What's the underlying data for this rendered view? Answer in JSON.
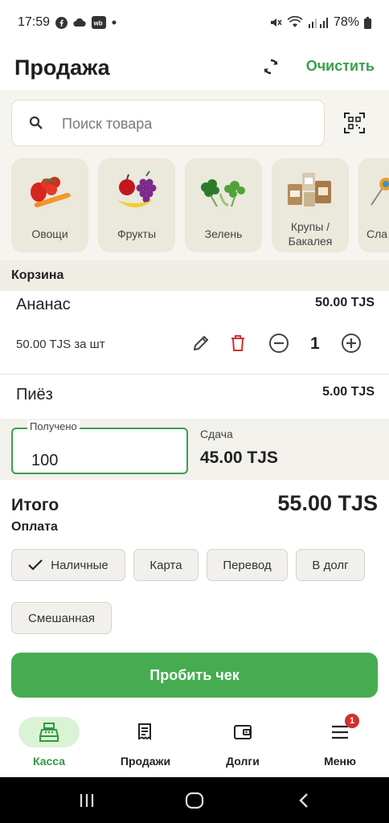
{
  "status_bar": {
    "time": "17:59",
    "battery": "78%"
  },
  "header": {
    "title": "Продажа",
    "clear_label": "Очистить"
  },
  "search": {
    "placeholder": "Поиск товара"
  },
  "categories": [
    {
      "label": "Овощи"
    },
    {
      "label": "Фрукты"
    },
    {
      "label": "Зелень"
    },
    {
      "label": "Крупы / Бакалея",
      "line1": "Крупы /",
      "line2": "Бакалея"
    },
    {
      "label": "Сла"
    }
  ],
  "cart": {
    "title": "Корзина",
    "items": [
      {
        "name": "Ананас",
        "total": "50.00 TJS",
        "unit_price": "50.00 TJS за шт",
        "quantity": "1"
      },
      {
        "name": "Пиёз",
        "total": "5.00 TJS"
      }
    ]
  },
  "payment": {
    "received_label": "Получено",
    "received_value": "100",
    "change_label": "Сдача",
    "change_value": "45.00 TJS",
    "total_label": "Итого",
    "total_value": "55.00 TJS",
    "method_title": "Оплата",
    "methods": [
      {
        "label": "Наличные",
        "selected": true
      },
      {
        "label": "Карта",
        "selected": false
      },
      {
        "label": "Перевод",
        "selected": false
      },
      {
        "label": "В долг",
        "selected": false
      },
      {
        "label": "Смешанная",
        "selected": false
      }
    ],
    "submit_label": "Пробить чек"
  },
  "bottom_nav": [
    {
      "label": "Касса",
      "icon": "cash-register-icon",
      "active": true
    },
    {
      "label": "Продажи",
      "icon": "receipt-icon",
      "active": false
    },
    {
      "label": "Долги",
      "icon": "wallet-icon",
      "active": false
    },
    {
      "label": "Меню",
      "icon": "menu-icon",
      "active": false,
      "badge": "1"
    }
  ],
  "colors": {
    "accent": "#45ad4f",
    "accent_text": "#3aa04a",
    "danger": "#d22f2f",
    "panel": "#f6f4ee"
  }
}
